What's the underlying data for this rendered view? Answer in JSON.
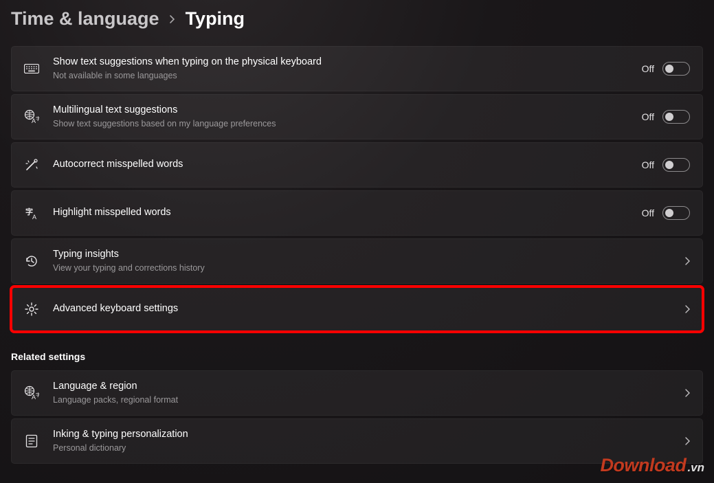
{
  "breadcrumb": {
    "parent": "Time & language",
    "current": "Typing"
  },
  "items": [
    {
      "title": "Show text suggestions when typing on the physical keyboard",
      "sub": "Not available in some languages",
      "toggle": {
        "state_label": "Off"
      }
    },
    {
      "title": "Multilingual text suggestions",
      "sub": "Show text suggestions based on my language preferences",
      "toggle": {
        "state_label": "Off"
      }
    },
    {
      "title": "Autocorrect misspelled words",
      "toggle": {
        "state_label": "Off"
      }
    },
    {
      "title": "Highlight misspelled words",
      "toggle": {
        "state_label": "Off"
      }
    },
    {
      "title": "Typing insights",
      "sub": "View your typing and corrections history"
    },
    {
      "title": "Advanced keyboard settings"
    }
  ],
  "related_heading": "Related settings",
  "related": [
    {
      "title": "Language & region",
      "sub": "Language packs, regional format"
    },
    {
      "title": "Inking & typing personalization",
      "sub": "Personal dictionary"
    }
  ],
  "watermark": {
    "main": "Download",
    "suffix": ".vn"
  }
}
